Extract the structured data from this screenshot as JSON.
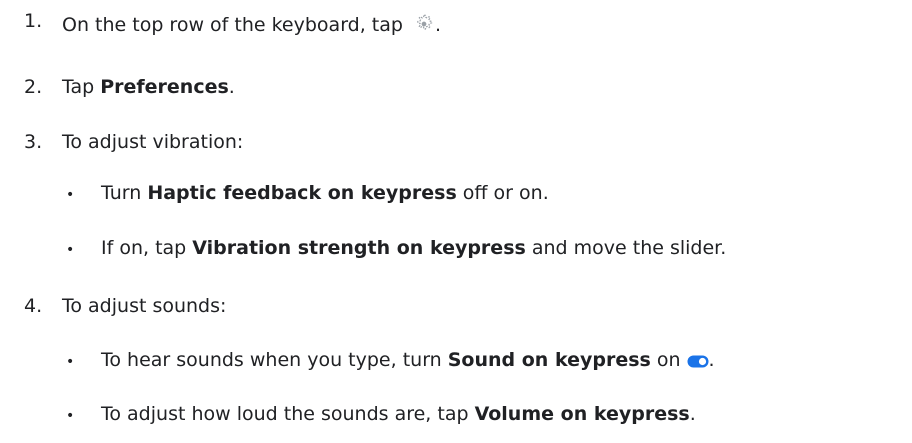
{
  "steps": [
    {
      "num": "1.",
      "pre": "On the top row of the keyboard, tap ",
      "post": "."
    },
    {
      "num": "2.",
      "pre": "Tap ",
      "bold": "Preferences",
      "post": "."
    },
    {
      "num": "3.",
      "text": "To adjust vibration:"
    },
    {
      "num": "4.",
      "text": "To adjust sounds:"
    }
  ],
  "vibration_bullets": [
    {
      "pre": "Turn ",
      "bold": "Haptic feedback on keypress",
      "post": " off or on."
    },
    {
      "pre": "If on, tap ",
      "bold": "Vibration strength on keypress",
      "post": " and move the slider."
    }
  ],
  "sound_bullets": [
    {
      "pre": "To hear sounds when you type, turn ",
      "bold": "Sound on keypress",
      "post": " on",
      "end": "."
    },
    {
      "pre": "To adjust how loud the sounds are, tap ",
      "bold": "Volume on keypress",
      "post": "."
    }
  ],
  "bullet_char": "•",
  "icons": {
    "settings": "gear-icon",
    "toggle": "toggle-on-icon"
  },
  "colors": {
    "text": "#202124",
    "icon_gray": "#9aa0a6",
    "toggle_blue": "#1a73e8"
  }
}
